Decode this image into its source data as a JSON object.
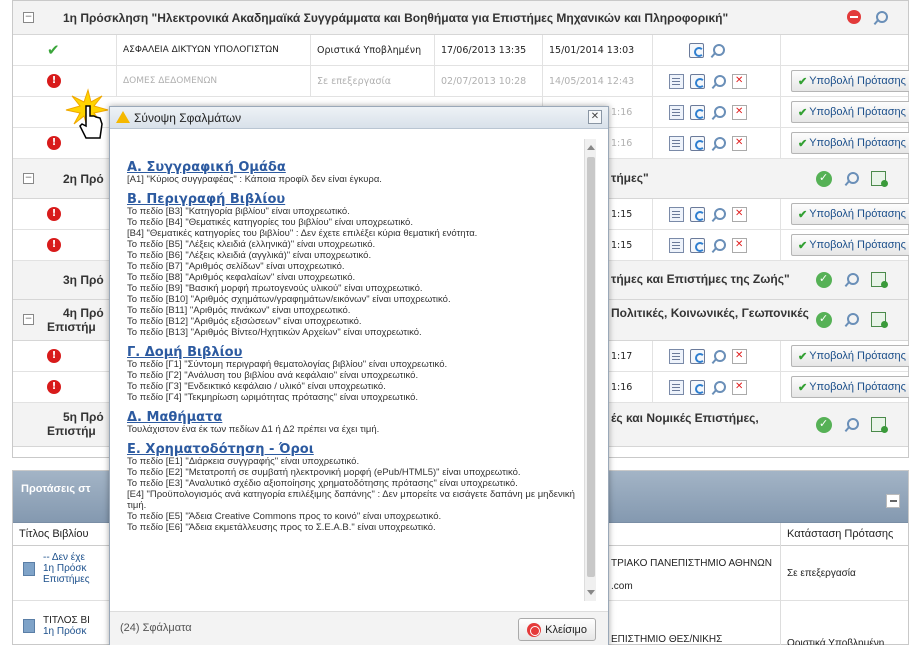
{
  "group1": {
    "title": "1η Πρόσκληση \"Ηλεκτρονικά Ακαδημαϊκά Συγγράμματα και Βοηθήματα για Επιστήμες Μηχανικών και Πληροφορική\""
  },
  "group2": {
    "title": "2η Πρό",
    "title_right": "τήμες\""
  },
  "group3": {
    "title": "3η Πρό",
    "title_right": "τήμες και Επιστήμες της Ζωής\""
  },
  "group4": {
    "title_l1": "4η Πρό",
    "title_l2": "Επιστήμ",
    "title_right": "Πολιτικές, Κοινωνικές, Γεωπονικές"
  },
  "group5": {
    "title_l1": "5η Πρό",
    "title_l2": "Επιστήμ",
    "title_right": "ές και Νομικές Επιστήμες,"
  },
  "rows": [
    {
      "name": "ΑΣΦΑΛΕΙΑ ΔΙΚΤΥΩΝ ΥΠΟΛΟΓΙΣΤΩΝ",
      "status": "Οριστικά Υποβλημένη",
      "created": "17/06/2013 13:35",
      "updated": "15/01/2014 13:03"
    },
    {
      "name": "ΔΟΜΕΣ ΔΕΔΟΜΕΝΩΝ",
      "status": "Σε επεξεργασία",
      "created": "02/07/2013 10:28",
      "updated": "14/05/2014 12:43"
    },
    {
      "tail": "1:16"
    },
    {
      "tail": "1:16"
    },
    {
      "tail": "1:15"
    },
    {
      "tail": "1:15"
    },
    {
      "tail": "1:17"
    },
    {
      "tail": "1:16"
    }
  ],
  "submit_label": "Υποβολή Πρότασης",
  "proposals": {
    "header": "Προτάσεις στ",
    "col_title": "Τίτλος Βιβλίου",
    "col_status": "Κατάσταση Πρότασης",
    "r1": {
      "l1": "-- Δεν έχε",
      "l2": "1η Πρόσκ",
      "l3": "Επιστήμες",
      "inst": "ΤΡΙΑΚΟ ΠΑΝΕΠΙΣΤΗΜΙΟ ΑΘΗΝΩΝ",
      "inst2": ".com",
      "status": "Σε επεξεργασία"
    },
    "r2": {
      "l1": "ΤΙΤΛΟΣ ΒΙ",
      "l2": "1η Πρόσκ",
      "inst": "ΕΠΙΣΤΗΜΙΟ ΘΕΣ/ΝΙΚΗΣ",
      "status": "Οριστικά Υποβλημένη"
    }
  },
  "modal": {
    "title": "Σύνοψη Σφαλμάτων",
    "count": "(24) Σφάλματα",
    "close_label": "Κλείσιμο",
    "sections": [
      {
        "heading": "Α. Συγγραφική Ομάδα",
        "lines": [
          "[Α1] \"Κύριος συγγραφέας\" : Κάποια προφίλ δεν είναι έγκυρα."
        ]
      },
      {
        "heading": "Β. Περιγραφή Βιβλίου",
        "lines": [
          "Το πεδίο [Β3] \"Κατηγορία βιβλίου\" είναι υποχρεωτικό.",
          "Το πεδίο [Β4] \"Θεματικές κατηγορίες του βιβλίου\" είναι υποχρεωτικό.",
          "[Β4] \"Θεματικές κατηγορίες του βιβλίου\" : Δεν έχετε επιλέξει κύρια θεματική ενότητα.",
          "Το πεδίο [Β5] \"Λέξεις κλειδιά (ελληνικά)\" είναι υποχρεωτικό.",
          "Το πεδίο [Β6] \"Λέξεις κλειδιά (αγγλικά)\" είναι υποχρεωτικό.",
          "Το πεδίο [Β7] \"Αριθμός σελίδων\" είναι υποχρεωτικό.",
          "Το πεδίο [Β8] \"Αριθμός κεφαλαίων\" είναι υποχρεωτικό.",
          "Το πεδίο [Β9] \"Βασική μορφή πρωτογενούς υλικού\" είναι υποχρεωτικό.",
          "Το πεδίο [Β10] \"Αριθμός σχημάτων/γραφημάτων/εικόνων\" είναι υποχρεωτικό.",
          "Το πεδίο [Β11] \"Αριθμός πινάκων\" είναι υποχρεωτικό.",
          "Το πεδίο [Β12] \"Αριθμός εξισώσεων\" είναι υποχρεωτικό.",
          "Το πεδίο [Β13] \"Αριθμός Βίντεο/Ηχητικών Αρχείων\" είναι υποχρεωτικό."
        ]
      },
      {
        "heading": "Γ. Δομή Βιβλίου",
        "lines": [
          "Το πεδίο [Γ1] \"Σύντομη περιγραφή θεματολογίας βιβλίου\" είναι υποχρεωτικό.",
          "Το πεδίο [Γ2] \"Ανάλυση του βιβλίου ανά κεφάλαιο\" είναι υποχρεωτικό.",
          "Το πεδίο [Γ3] \"Ενδεικτικό κεφάλαιο / υλικό\" είναι υποχρεωτικό.",
          "Το πεδίο [Γ4] \"Τεκμηρίωση ωριμότητας πρότασης\" είναι υποχρεωτικό."
        ]
      },
      {
        "heading": "Δ. Μαθήματα",
        "lines": [
          "Τουλάχιστον ένα έκ των πεδίων Δ1 ή Δ2 πρέπει να έχει τιμή."
        ]
      },
      {
        "heading": "Ε. Χρηματοδότηση - Όροι",
        "lines": [
          "Το πεδίο [Ε1] \"Διάρκεια συγγραφής\" είναι υποχρεωτικό.",
          "Το πεδίο [Ε2] \"Μετατροπή σε συμβατή ηλεκτρονική μορφή (ePub/HTML5)\" είναι υποχρεωτικό.",
          "Το πεδίο [Ε3] \"Αναλυτικό σχέδιο αξιοποίησης χρηματοδότησης πρότασης\" είναι υποχρεωτικό.",
          "[Ε4] \"Προϋπολογισμός ανά κατηγορία επιλέξιμης δαπάνης\" : Δεν μπορείτε να εισάγετε δαπάνη με μηδενική τιμή.",
          "Το πεδίο [Ε5] \"Άδεια Creative Commons προς το κοινό\" είναι υποχρεωτικό.",
          "Το πεδίο [Ε6] \"Άδεια εκμετάλλευσης προς το Σ.Ε.Α.Β.\" είναι υποχρεωτικό."
        ]
      }
    ]
  }
}
